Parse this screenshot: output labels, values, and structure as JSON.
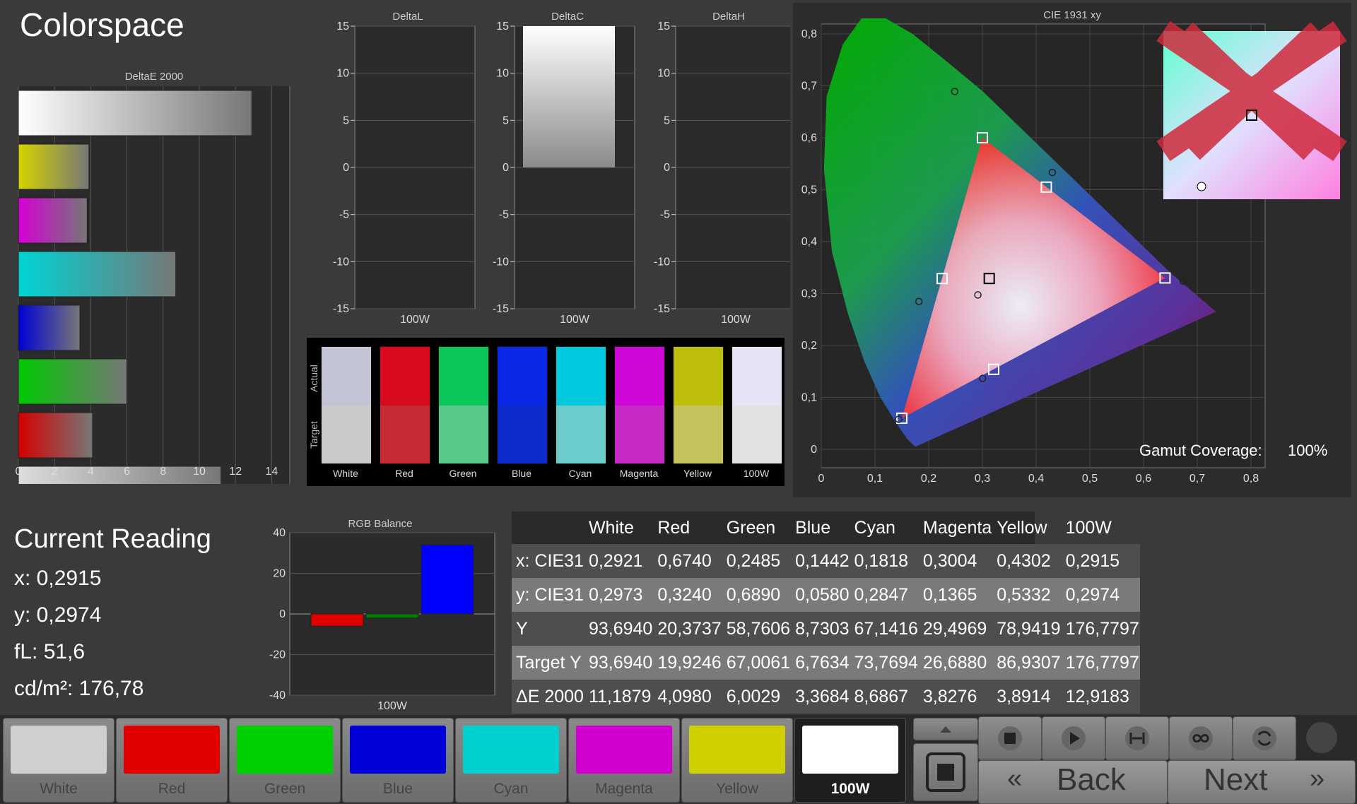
{
  "app": {
    "title": "Colorspace"
  },
  "deltae_chart": {
    "title": "DeltaE 2000",
    "ticks": [
      "0",
      "2",
      "4",
      "6",
      "8",
      "10",
      "12",
      "14"
    ]
  },
  "delta_charts": [
    {
      "title": "DeltaL",
      "xlabel": "100W"
    },
    {
      "title": "DeltaC",
      "xlabel": "100W"
    },
    {
      "title": "DeltaH",
      "xlabel": "100W"
    }
  ],
  "delta_ticks": [
    "15",
    "10",
    "5",
    "0",
    "-5",
    "-10",
    "-15"
  ],
  "swatch_panel": {
    "actual_label": "Actual",
    "target_label": "Target",
    "swatches": [
      {
        "label": "White",
        "actual": "#c3c3d6",
        "target": "#c9c9c9"
      },
      {
        "label": "Red",
        "actual": "#d80a1e",
        "target": "#c62a34"
      },
      {
        "label": "Green",
        "actual": "#0bc658",
        "target": "#57c98a"
      },
      {
        "label": "Blue",
        "actual": "#0a28e6",
        "target": "#0e2ccc"
      },
      {
        "label": "Cyan",
        "actual": "#03c9de",
        "target": "#6dcccc"
      },
      {
        "label": "Magenta",
        "actual": "#cf06d8",
        "target": "#c529c6"
      },
      {
        "label": "Yellow",
        "actual": "#bdbf0a",
        "target": "#c4c25a"
      },
      {
        "label": "100W",
        "actual": "#e4e4f6",
        "target": "#e2e2e2"
      }
    ]
  },
  "cie_chart": {
    "title": "CIE 1931 xy",
    "x_ticks": [
      "0",
      "0,1",
      "0,2",
      "0,3",
      "0,4",
      "0,5",
      "0,6",
      "0,7",
      "0,8"
    ],
    "y_ticks": [
      "0",
      "0,1",
      "0,2",
      "0,3",
      "0,4",
      "0,5",
      "0,6",
      "0,7",
      "0,8"
    ],
    "gamut_label": "Gamut Coverage:",
    "gamut_value": "100%"
  },
  "current_reading": {
    "title": "Current Reading",
    "x": "x: 0,2915",
    "y": "y: 0,2974",
    "fl": "fL: 51,6",
    "cdm2": "cd/m²: 176,78"
  },
  "rgb_chart": {
    "title": "RGB Balance",
    "xlabel": "100W",
    "ticks": [
      "40",
      "20",
      "0",
      "-20",
      "-40"
    ]
  },
  "table": {
    "headers": [
      "",
      "White",
      "Red",
      "Green",
      "Blue",
      "Cyan",
      "Magenta",
      "Yellow",
      "100W"
    ],
    "rows": [
      [
        "x: CIE31",
        "0,2921",
        "0,6740",
        "0,2485",
        "0,1442",
        "0,1818",
        "0,3004",
        "0,4302",
        "0,2915"
      ],
      [
        "y: CIE31",
        "0,2973",
        "0,3240",
        "0,6890",
        "0,0580",
        "0,2847",
        "0,1365",
        "0,5332",
        "0,2974"
      ],
      [
        "Y",
        "93,6940",
        "20,3737",
        "58,7606",
        "8,7303",
        "67,1416",
        "29,4969",
        "78,9419",
        "176,7797"
      ],
      [
        "Target Y",
        "93,6940",
        "19,9246",
        "67,0061",
        "6,7634",
        "73,7694",
        "26,6880",
        "86,9307",
        "176,7797"
      ],
      [
        "ΔE 2000",
        "11,1879",
        "4,0980",
        "6,0029",
        "3,3684",
        "8,6867",
        "3,8276",
        "3,8914",
        "12,9183"
      ]
    ]
  },
  "bottom_bar": {
    "color_buttons": [
      {
        "label": "White",
        "color": "#cfcfcf"
      },
      {
        "label": "Red",
        "color": "#e00000"
      },
      {
        "label": "Green",
        "color": "#00d000"
      },
      {
        "label": "Blue",
        "color": "#0000d8"
      },
      {
        "label": "Cyan",
        "color": "#00d0d0"
      },
      {
        "label": "Magenta",
        "color": "#d000d0"
      },
      {
        "label": "Yellow",
        "color": "#d0d000"
      },
      {
        "label": "100W",
        "color": "#ffffff"
      }
    ],
    "back_label": "Back",
    "next_label": "Next"
  },
  "chart_data": [
    {
      "type": "bar",
      "orientation": "horizontal",
      "title": "DeltaE 2000",
      "categories": [
        "100W",
        "Yellow",
        "Magenta",
        "Cyan",
        "Blue",
        "Green",
        "Red",
        "White"
      ],
      "values": [
        12.9,
        3.9,
        3.8,
        8.7,
        3.4,
        6.0,
        4.1,
        11.2
      ],
      "colors": [
        "#ffffff",
        "#d4d400",
        "#d400d4",
        "#00d4d4",
        "#0000d4",
        "#00c800",
        "#d40000",
        "#dddddd"
      ],
      "xlim": [
        0,
        15
      ]
    },
    {
      "type": "bar",
      "title": "DeltaL",
      "categories": [
        "100W"
      ],
      "values": [
        0
      ],
      "ylim": [
        -15,
        15
      ]
    },
    {
      "type": "bar",
      "title": "DeltaC",
      "categories": [
        "100W"
      ],
      "values": [
        15
      ],
      "ylim": [
        -15,
        15
      ]
    },
    {
      "type": "bar",
      "title": "DeltaH",
      "categories": [
        "100W"
      ],
      "values": [
        0
      ],
      "ylim": [
        -15,
        15
      ]
    },
    {
      "type": "scatter",
      "title": "CIE 1931 xy",
      "xlim": [
        0,
        0.8
      ],
      "ylim": [
        0,
        0.8
      ],
      "series": [
        {
          "name": "target",
          "points": [
            [
              0.64,
              0.33
            ],
            [
              0.3,
              0.6
            ],
            [
              0.15,
              0.06
            ],
            [
              0.3127,
              0.329
            ],
            [
              0.225,
              0.329
            ],
            [
              0.321,
              0.154
            ],
            [
              0.419,
              0.505
            ]
          ]
        },
        {
          "name": "measured",
          "points": [
            [
              0.674,
              0.324
            ],
            [
              0.2485,
              0.689
            ],
            [
              0.1442,
              0.058
            ],
            [
              0.2915,
              0.2974
            ],
            [
              0.1818,
              0.2847
            ],
            [
              0.3004,
              0.1365
            ],
            [
              0.4302,
              0.5332
            ]
          ]
        }
      ]
    },
    {
      "type": "bar",
      "title": "RGB Balance",
      "categories": [
        "Red",
        "Green",
        "Blue"
      ],
      "values": [
        -6,
        -2,
        34
      ],
      "colors": [
        "#e00000",
        "#008000",
        "#0000ff"
      ],
      "ylim": [
        -40,
        40
      ]
    }
  ]
}
